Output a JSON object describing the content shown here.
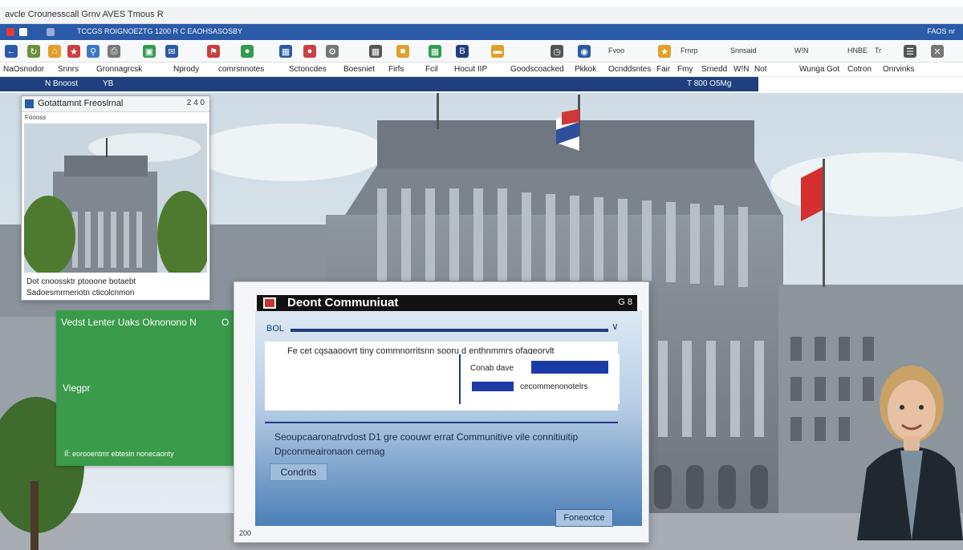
{
  "colors": {
    "accent": "#2a5aa8",
    "dark_blue": "#1f3f7e",
    "green_panel": "#3a9b4a",
    "button_blue": "#1c3aa8"
  },
  "window": {
    "title": "avcle Crounesscall Grnv AVES Tmous R"
  },
  "tabs": {
    "text": "TCCGS ROIGNOEZTG 1200 R C EAOHSASOSBY",
    "right_text": "FAOS nr"
  },
  "toolbar": {
    "labels": [
      "Fvoo",
      "Frnrp",
      "Snnsaid",
      "W!N"
    ],
    "right_labels": [
      "HNBE",
      "Tr"
    ]
  },
  "bookmarks": [
    "NaOsnodor",
    "Snnrs",
    "Gronnagrcsk",
    "Nprody",
    "comrsnnotes",
    "Sctoncdes",
    "Boesniet",
    "Firfs",
    "Fcil",
    "Hocut IIP",
    "Goodscoacked",
    "Pkkok",
    "Ocnddsntes",
    "Fair",
    "Fmy",
    "Srnedd",
    "W!N",
    "Not",
    "Wunga",
    "Got",
    "Cotron",
    "Onrvinks"
  ],
  "address": {
    "left": "N Bnoost",
    "number": "YB",
    "right": "T 800 O5Mg"
  },
  "thumbnail": {
    "title": "Gotattamnt Freoslrnal",
    "sub": "Foooss",
    "controls": "2 4 0",
    "caption1": "Dot cnoossktr ptooone botaebt",
    "caption2": "Sadoesmrmeriotn cticolcnmon"
  },
  "green_panel": {
    "heading": "Vedst Lenter Uaks Oknonono N",
    "heading_mark": "O",
    "middle": "Viegpr",
    "footer": "IÎ: eorooentmr ebtesin nonecaonty"
  },
  "dialog": {
    "title": "Deont Communiuat",
    "controls": "G 8",
    "field_label": "BOL",
    "description": "Fe cet cqsaaoovrt tiny commnorritsnn sooru d enthnmmrs ofageorvlt",
    "inner_label": "Conab dave",
    "inner_label2": "cecommenonotelrs",
    "message1": "Seoupcaaronatrvdost D1 gre coouwr errat Communitive vile connitiuitip",
    "message2": "Dpconmeaironaon cemag",
    "confirm_button": "Condrits",
    "proceed_button": "Foneoctce",
    "footer": "200"
  }
}
